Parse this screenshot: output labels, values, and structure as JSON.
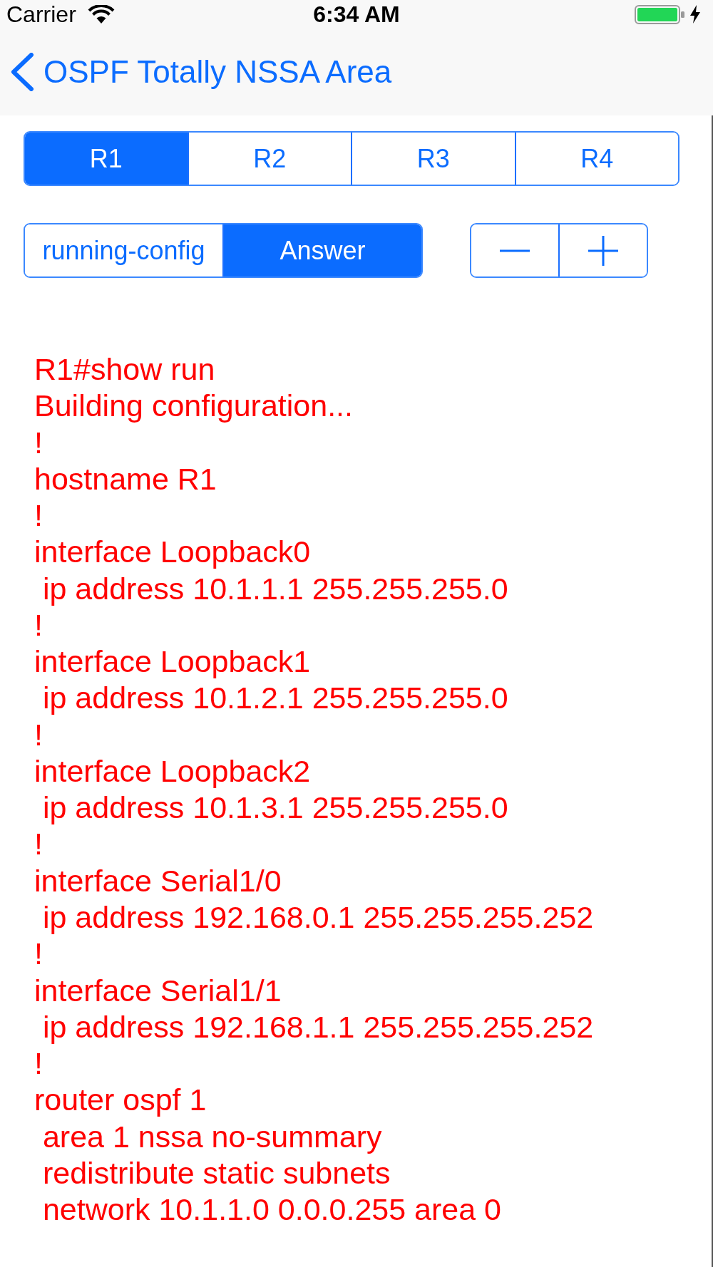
{
  "status_bar": {
    "carrier": "Carrier",
    "time": "6:34 AM",
    "charging": true
  },
  "nav_bar": {
    "back_button": {
      "label": "OSPF Totally NSSA Area"
    }
  },
  "router_tabs": [
    {
      "label": "R1",
      "selected": true
    },
    {
      "label": "R2",
      "selected": false
    },
    {
      "label": "R3",
      "selected": false
    },
    {
      "label": "R4",
      "selected": false
    }
  ],
  "view_toggle": [
    {
      "label": "running-config",
      "selected": false
    },
    {
      "label": "Answer",
      "selected": true
    }
  ],
  "font_stepper": [
    {
      "kind": "minus"
    },
    {
      "kind": "plus"
    }
  ],
  "config_lines": [
    "R1#show run",
    "Building configuration...",
    "!",
    "hostname R1",
    "!",
    "interface Loopback0",
    " ip address 10.1.1.1 255.255.255.0",
    "!",
    "interface Loopback1",
    " ip address 10.1.2.1 255.255.255.0",
    "!",
    "interface Loopback2",
    " ip address 10.1.3.1 255.255.255.0",
    "!",
    "interface Serial1/0",
    " ip address 192.168.0.1 255.255.255.252",
    "!",
    "interface Serial1/1",
    " ip address 192.168.1.1 255.255.255.252",
    "!",
    "router ospf 1",
    " area 1 nssa no-summary",
    " redistribute static subnets",
    " network 10.1.1.0 0.0.0.255 area 0"
  ]
}
